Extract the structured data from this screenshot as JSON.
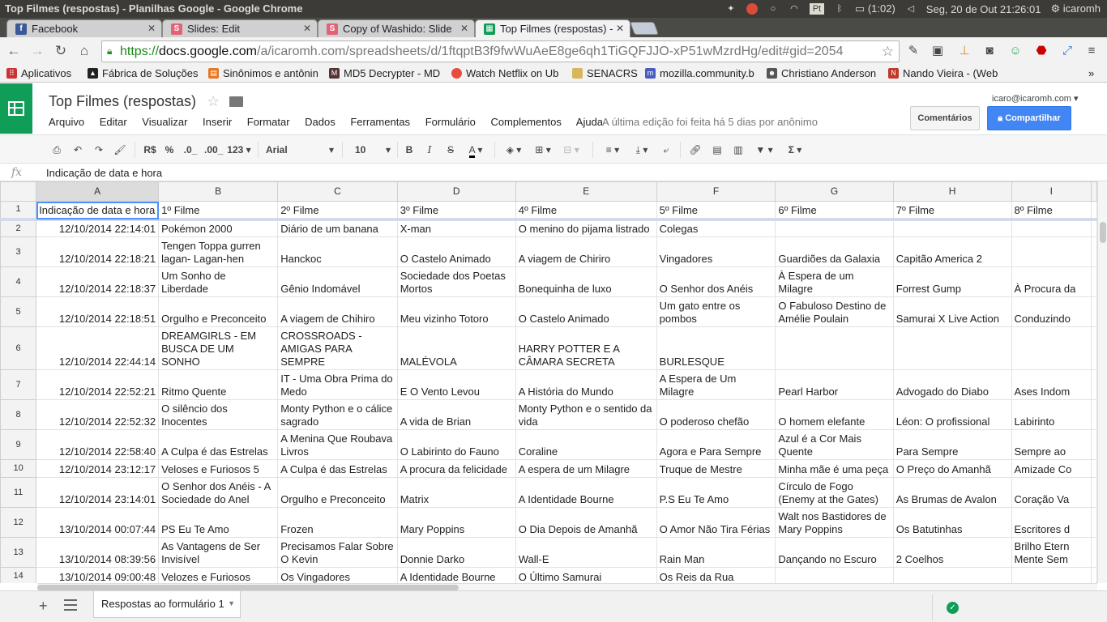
{
  "window_title": "Top Filmes (respostas) - Planilhas Google - Google Chrome",
  "system_tray": {
    "battery": "(1:02)",
    "datetime": "Seg, 20 de Out 21:26:01",
    "user": "icaromh"
  },
  "tabs": [
    {
      "label": "Facebook",
      "favicon": "f",
      "color": "#3b5998"
    },
    {
      "label": "Slides: Edit",
      "favicon": "S",
      "color": "#e06377"
    },
    {
      "label": "Copy of Washido: Slide",
      "favicon": "S",
      "color": "#e06377"
    },
    {
      "label": "Top Filmes (respostas) -",
      "favicon": "▦",
      "color": "#0f9d58"
    }
  ],
  "omnibox": {
    "scheme": "https://",
    "host": "docs.google.com",
    "path": "/a/icaromh.com/spreadsheets/d/1ftqptB3f9fwWuAeE8ge6qh1TiGQFJJO-xP51wMzrdHg/edit#gid=2054"
  },
  "bookmarks": [
    {
      "label": "Aplicativos",
      "icon": "apps-grid-icon",
      "color": "#c33"
    },
    {
      "label": "Fábrica de Soluções",
      "icon": "triangle-logo-icon",
      "color": "#222"
    },
    {
      "label": "Sinônimos e antônin",
      "icon": "book-icon",
      "color": "#e87722"
    },
    {
      "label": "MD5 Decrypter - MD",
      "icon": "md5-icon",
      "color": "#533"
    },
    {
      "label": "Watch Netflix on Ub",
      "icon": "netflix-icon",
      "color": "#e74c3c"
    },
    {
      "label": "SENACRS",
      "icon": "folder-icon",
      "color": "#d8b65a"
    },
    {
      "label": "mozilla.community.b",
      "icon": "mozilla-icon",
      "color": "#4a5ec2"
    },
    {
      "label": "Christiano Anderson",
      "icon": "avatar-icon",
      "color": "#555"
    },
    {
      "label": "Nando Vieira - (Web",
      "icon": "nando-icon",
      "color": "#c0392b"
    }
  ],
  "document": {
    "title": "Top Filmes (respostas)",
    "menus": [
      "Arquivo",
      "Editar",
      "Visualizar",
      "Inserir",
      "Formatar",
      "Dados",
      "Ferramentas",
      "Formulário",
      "Complementos",
      "Ajuda"
    ],
    "last_edit": "A última edição foi feita há 5 dias por anônimo",
    "user_email": "icaro@icaromh.com",
    "comments_label": "Comentários",
    "share_label": "Compartilhar"
  },
  "toolbar": {
    "currency": "R$",
    "percent": "%",
    "dec_less": ".0_",
    "dec_more": ".00_",
    "number_format": "123",
    "font": "Arial",
    "font_size": "10",
    "bold": "B",
    "italic": "I",
    "strike": "S",
    "text_color": "A",
    "sum": "Σ"
  },
  "formula_bar": {
    "fx": "fx",
    "content": "Indicação de data e hora"
  },
  "sheet": {
    "columns": [
      "A",
      "B",
      "C",
      "D",
      "E",
      "F",
      "G",
      "H",
      "I"
    ],
    "rows": [
      {
        "n": "1",
        "cells": [
          "Indicação de data e hora",
          "1º Filme",
          "2º Filme",
          "3º Filme",
          "4º Filme",
          "5º Filme",
          "6º Filme",
          "7º Filme",
          "8º Filme"
        ]
      },
      {
        "n": "2",
        "cells": [
          "12/10/2014 22:14:01",
          "Pokémon 2000",
          "Diário de um banana",
          "X-man",
          "O menino do pijama listrado",
          "Colegas",
          "",
          "",
          ""
        ]
      },
      {
        "n": "3",
        "cells": [
          "12/10/2014 22:18:21",
          "Tengen Toppa gurren lagan- Lagan-hen",
          "Hanckoc",
          "O Castelo Animado",
          "A viagem de Chiriro",
          "Vingadores",
          "Guardiões da Galaxia",
          "Capitão America 2",
          ""
        ]
      },
      {
        "n": "4",
        "cells": [
          "12/10/2014 22:18:37",
          "Um Sonho de Liberdade",
          "Gênio Indomável",
          "Sociedade dos Poetas Mortos",
          "Bonequinha de luxo",
          "O Senhor dos Anéis",
          "À Espera de um Milagre",
          "Forrest Gump",
          "À Procura da"
        ]
      },
      {
        "n": "5",
        "cells": [
          "12/10/2014 22:18:51",
          "Orgulho e Preconceito",
          "A viagem de Chihiro",
          "Meu vizinho Totoro",
          "O Castelo Animado",
          "Um gato entre os pombos",
          "O Fabuloso Destino de Amélie Poulain",
          "Samurai X Live Action",
          "Conduzindo"
        ]
      },
      {
        "n": "6",
        "cells": [
          "12/10/2014 22:44:14",
          "DREAMGIRLS - EM BUSCA DE UM SONHO",
          "CROSSROADS - AMIGAS PARA SEMPRE",
          "MALÉVOLA",
          "HARRY POTTER E A CÂMARA SECRETA",
          "BURLESQUE",
          "",
          "",
          ""
        ]
      },
      {
        "n": "7",
        "cells": [
          "12/10/2014 22:52:21",
          "Ritmo Quente",
          "IT - Uma Obra Prima do Medo",
          "E O Vento Levou",
          "A História do Mundo",
          "A Espera de Um Milagre",
          "Pearl Harbor",
          "Advogado do Diabo",
          "Ases Indom"
        ]
      },
      {
        "n": "8",
        "cells": [
          "12/10/2014 22:52:32",
          "O silêncio dos Inocentes",
          "Monty Python e o cálice sagrado",
          "A vida de Brian",
          "Monty Python e o sentido da vida",
          "O poderoso chefão",
          "O homem elefante",
          "Léon: O profissional",
          "Labirinto"
        ]
      },
      {
        "n": "9",
        "cells": [
          "12/10/2014 22:58:40",
          "A Culpa é das Estrelas",
          "A Menina Que Roubava Livros",
          "O Labirinto do Fauno",
          "Coraline",
          "Agora e Para Sempre",
          "Azul é a Cor Mais Quente",
          "Para Sempre",
          "Sempre ao"
        ]
      },
      {
        "n": "10",
        "cells": [
          "12/10/2014 23:12:17",
          "Veloses e Furiosos 5",
          "A Culpa é das Estrelas",
          "A procura da felicidade",
          "A espera de um Milagre",
          "Truque de Mestre",
          "Minha mãe é uma peça",
          "O Preço do Amanhã",
          "Amizade Co"
        ]
      },
      {
        "n": "11",
        "cells": [
          "12/10/2014 23:14:01",
          "O Senhor dos Anéis - A Sociedade do Anel",
          "Orgulho e Preconceito",
          "Matrix",
          "A Identidade Bourne",
          "P.S Eu Te Amo",
          "Círculo de Fogo (Enemy at the Gates)",
          "As Brumas de Avalon",
          "Coração Va"
        ]
      },
      {
        "n": "12",
        "cells": [
          "13/10/2014 00:07:44",
          "PS Eu Te Amo",
          "Frozen",
          "Mary Poppins",
          "O Dia Depois de Amanhã",
          "O Amor Não Tira Férias",
          "Walt nos Bastidores de Mary Poppins",
          "Os Batutinhas",
          "Escritores d"
        ]
      },
      {
        "n": "13",
        "cells": [
          "13/10/2014 08:39:56",
          "As Vantagens de Ser Invisível",
          "Precisamos Falar Sobre O Kevin",
          "Donnie Darko",
          "Wall-E",
          "Rain Man",
          "Dançando no Escuro",
          "2 Coelhos",
          "Brilho Etern Mente Sem"
        ]
      },
      {
        "n": "14",
        "cells": [
          "13/10/2014 09:00:48",
          "Velozes e Furiosos",
          "Os Vingadores",
          "A Identidade Bourne",
          "O Último Samurai",
          "Os Reis da Rua",
          "",
          "",
          ""
        ]
      }
    ]
  },
  "bottom": {
    "add_sheet": "+",
    "sheet_tab": "Respostas ao formulário 1",
    "saved_check": "✓"
  }
}
